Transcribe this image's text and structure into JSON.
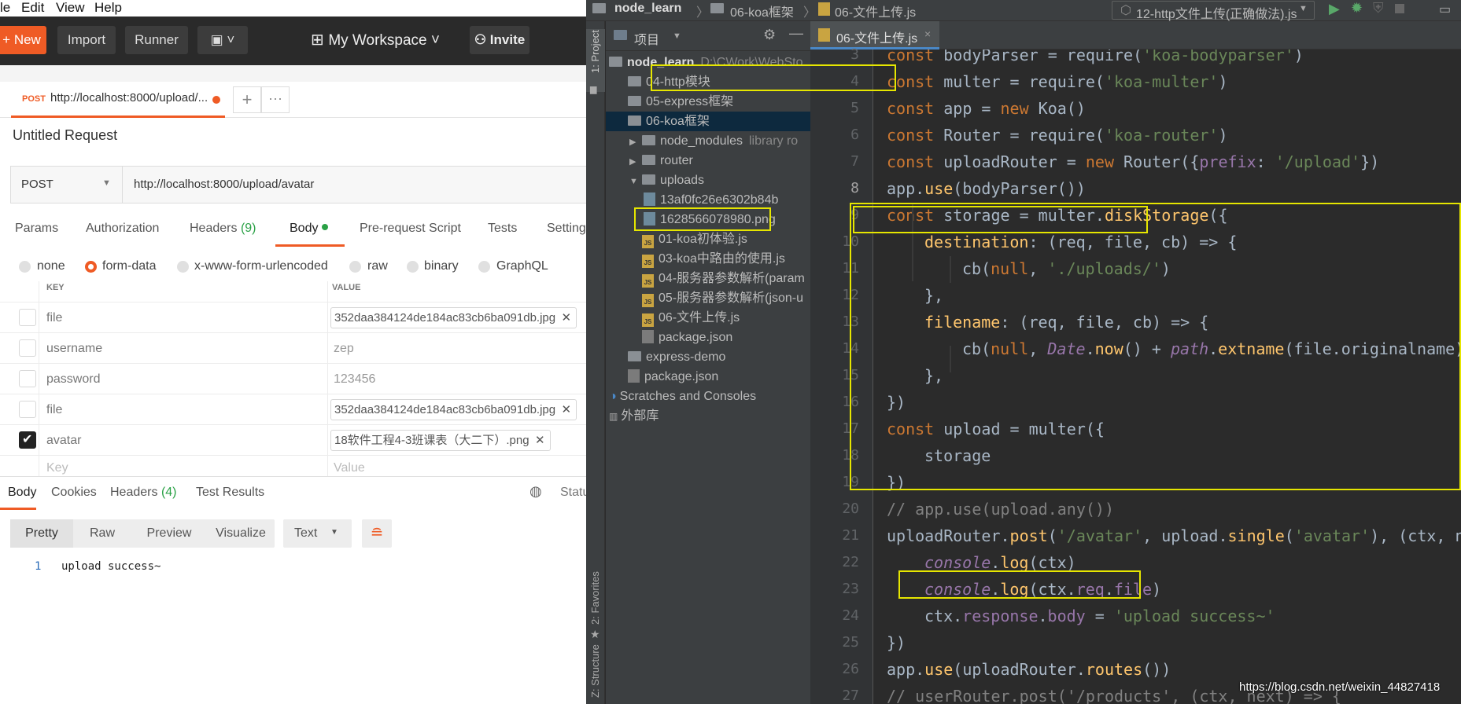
{
  "postman": {
    "menu": [
      "le",
      "Edit",
      "View",
      "Help"
    ],
    "toolbar": {
      "new": "New",
      "import": "Import",
      "runner": "Runner",
      "workspace": "My Workspace",
      "invite": "Invite"
    },
    "tab": {
      "method": "POST",
      "url": "http://localhost:8000/upload/..."
    },
    "request_title": "Untitled Request",
    "method": "POST",
    "url": "http://localhost:8000/upload/avatar",
    "subtabs": {
      "params": "Params",
      "auth": "Authorization",
      "headers": "Headers",
      "headers_count": "(9)",
      "body": "Body",
      "prereq": "Pre-request Script",
      "tests": "Tests",
      "settings": "Settings"
    },
    "body_types": [
      "none",
      "form-data",
      "x-www-form-urlencoded",
      "raw",
      "binary",
      "GraphQL"
    ],
    "table_headers": {
      "key": "KEY",
      "value": "VALUE"
    },
    "rows": [
      {
        "key": "file",
        "value": "352daa384124de184ac83cb6ba091db.jpg",
        "is_file": true,
        "checked": false
      },
      {
        "key": "username",
        "value": "zep",
        "is_file": false,
        "checked": false
      },
      {
        "key": "password",
        "value": "123456",
        "is_file": false,
        "checked": false
      },
      {
        "key": "file",
        "value": "352daa384124de184ac83cb6ba091db.jpg",
        "is_file": true,
        "checked": false
      },
      {
        "key": "avatar",
        "value": "18软件工程4-3班课表（大二下）.png",
        "is_file": true,
        "checked": true
      }
    ],
    "placeholder_row": {
      "key": "Key",
      "value": "Value"
    },
    "response_tabs": {
      "body": "Body",
      "cookies": "Cookies",
      "headers": "Headers",
      "headers_count": "(4)",
      "tests": "Test Results",
      "status": "Statu"
    },
    "view_modes": [
      "Pretty",
      "Raw",
      "Preview",
      "Visualize"
    ],
    "format": "Text",
    "response": {
      "line": "1",
      "text": "upload success~"
    }
  },
  "ide": {
    "breadcrumb": [
      "node_learn",
      "06-koa框架",
      "06-文件上传.js"
    ],
    "run_config": "12-http文件上传(正确做法).js",
    "project_label": "项目",
    "editor_tab": "06-文件上传.js",
    "side_labels": {
      "project": "1: Project",
      "favorites": "2: Favorites",
      "structure": "Z: Structure"
    },
    "tree": [
      {
        "label": "node_learn",
        "suffix": "D:\\CWork\\WebSto",
        "indent": 0,
        "type": "root"
      },
      {
        "label": "04-http模块",
        "indent": 1,
        "type": "folder"
      },
      {
        "label": "05-express框架",
        "indent": 1,
        "type": "folder"
      },
      {
        "label": "06-koa框架",
        "indent": 1,
        "type": "folder",
        "selected": true
      },
      {
        "label": "node_modules",
        "suffix": "library ro",
        "indent": 2,
        "type": "folder",
        "arrow": "▶"
      },
      {
        "label": "router",
        "indent": 2,
        "type": "folder",
        "arrow": "▶"
      },
      {
        "label": "uploads",
        "indent": 2,
        "type": "folder",
        "arrow": "▼"
      },
      {
        "label": "13af0fc26e6302b84b",
        "indent": 3,
        "type": "png"
      },
      {
        "label": "1628566078980.png",
        "indent": 3,
        "type": "png"
      },
      {
        "label": "01-koa初体验.js",
        "indent": 2,
        "type": "js"
      },
      {
        "label": "03-koa中路由的使用.js",
        "indent": 2,
        "type": "js"
      },
      {
        "label": "04-服务器参数解析(param",
        "indent": 2,
        "type": "js"
      },
      {
        "label": "05-服务器参数解析(json-u",
        "indent": 2,
        "type": "js"
      },
      {
        "label": "06-文件上传.js",
        "indent": 2,
        "type": "js"
      },
      {
        "label": "package.json",
        "indent": 2,
        "type": "json"
      },
      {
        "label": "express-demo",
        "indent": 1,
        "type": "folder"
      },
      {
        "label": "package.json",
        "indent": 1,
        "type": "json"
      },
      {
        "label": "Scratches and Consoles",
        "indent": 0,
        "type": "scratch"
      },
      {
        "label": "外部库",
        "indent": 0,
        "type": "lib"
      }
    ],
    "lines": [
      {
        "n": "3",
        "html": "<span class='kw'>const</span> bodyParser = require(<span class='st'>'koa-bodyparser'</span>)",
        "ind": 0
      },
      {
        "n": "4",
        "html": "<span class='kw'>const</span> multer = require(<span class='st'>'koa-multer'</span>)",
        "ind": 0
      },
      {
        "n": "5",
        "html": "<span class='kw'>const</span> app = <span class='kw'>new</span> Koa()",
        "ind": 0
      },
      {
        "n": "6",
        "html": "<span class='kw'>const</span> Router = require(<span class='st'>'koa-router'</span>)",
        "ind": 0
      },
      {
        "n": "7",
        "html": "<span class='kw'>const</span> uploadRouter = <span class='kw'>new</span> Router({<span class='pr'>prefix</span>: <span class='st'>'/upload'</span>})",
        "ind": 0
      },
      {
        "n": "8",
        "html": "app.<span class='fn'>use</span>(bodyParser())",
        "ind": 0
      },
      {
        "n": "9",
        "html": "<span class='kw'>const</span> storage = multer.<span class='fn'>diskStorage</span>({",
        "ind": 0
      },
      {
        "n": "10",
        "html": "<span class='fx'>destination</span>: (req, file, cb) => {",
        "ind": 1
      },
      {
        "n": "11",
        "html": "cb(<span class='kw'>null</span>, <span class='st'>'./uploads/'</span>)",
        "ind": 2
      },
      {
        "n": "12",
        "html": "},",
        "ind": 1
      },
      {
        "n": "13",
        "html": "<span class='fx'>filename</span>: (req, file, cb) => {",
        "ind": 1
      },
      {
        "n": "14",
        "html": "cb(<span class='kw'>null</span>, <span class='it'>Date</span>.<span class='fn'>now</span>() + <span class='it'>path</span>.<span class='fn'>extname</span>(file.originalname))",
        "ind": 2
      },
      {
        "n": "15",
        "html": "},",
        "ind": 1
      },
      {
        "n": "16",
        "html": "})",
        "ind": 0
      },
      {
        "n": "17",
        "html": "<span class='kw'>const</span> upload = multer({",
        "ind": 0
      },
      {
        "n": "18",
        "html": "storage",
        "ind": 1
      },
      {
        "n": "19",
        "html": "})",
        "ind": 0
      },
      {
        "n": "20",
        "html": "<span class='cm'>// app.use(upload.any())</span>",
        "ind": 0
      },
      {
        "n": "21",
        "html": "uploadRouter.<span class='fn'>post</span>(<span class='st'>'/avatar'</span>, upload.<span class='fn'>single</span>(<span class='st'>'avatar'</span>), (ctx, nex",
        "ind": 0
      },
      {
        "n": "22",
        "html": "<span class='it'>console</span>.<span class='fn'>log</span>(ctx)",
        "ind": 1
      },
      {
        "n": "23",
        "html": "<span class='it'>console</span>.<span class='fn'>log</span>(ctx.<span class='pr'>req</span>.<span class='pr'>file</span>)",
        "ind": 1
      },
      {
        "n": "24",
        "html": "ctx.<span class='pr'>response</span>.<span class='pr'>body</span> = <span class='st'>'upload success~'</span>",
        "ind": 1
      },
      {
        "n": "25",
        "html": "})",
        "ind": 0
      },
      {
        "n": "26",
        "html": "app.<span class='fn'>use</span>(uploadRouter.<span class='fn'>routes</span>())",
        "ind": 0
      },
      {
        "n": "27",
        "html": "<span class='cm'>// userRouter.post('/products', (ctx, next) => {</span>",
        "ind": 0
      }
    ],
    "watermark": "https://blog.csdn.net/weixin_44827418"
  },
  "colors": {
    "accent": "#ef5b25",
    "highlight": "#e6e600",
    "selection": "#0d293e"
  }
}
